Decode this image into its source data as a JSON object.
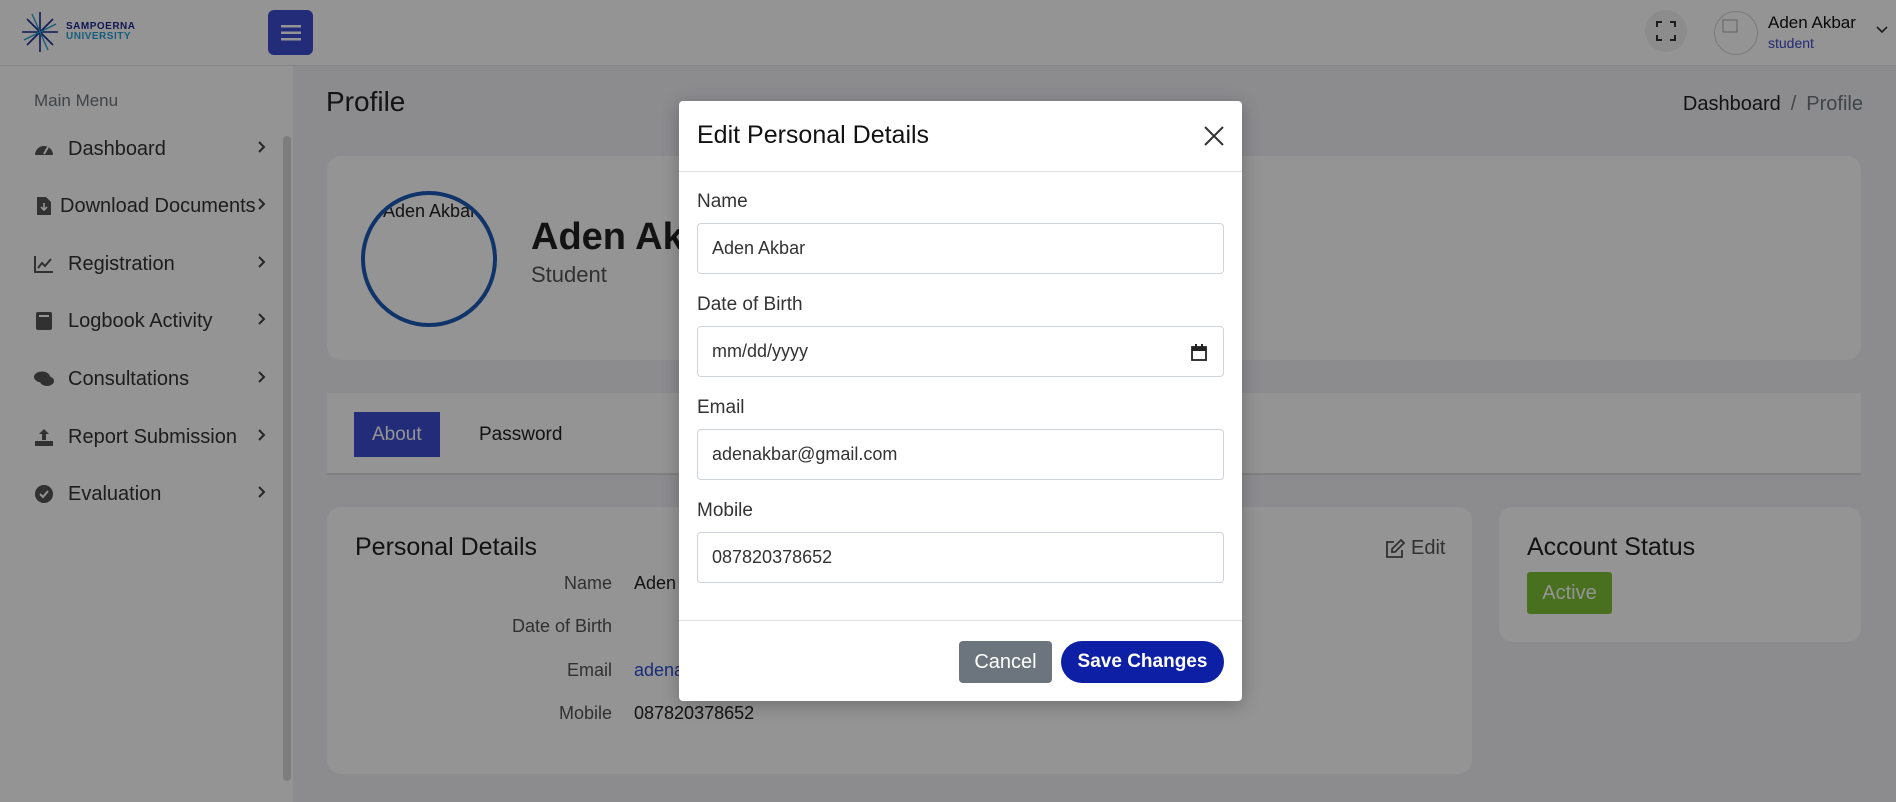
{
  "header": {
    "logo_line1": "SAMPOERNA",
    "logo_line2": "UNIVERSITY",
    "user_name": "Aden Akbar",
    "user_role": "student"
  },
  "sidebar": {
    "heading": "Main Menu",
    "items": [
      {
        "label": "Dashboard",
        "icon": "dashboard-gauge-icon"
      },
      {
        "label": "Download Documents",
        "icon": "file-download-icon"
      },
      {
        "label": "Registration",
        "icon": "chart-edit-icon"
      },
      {
        "label": "Logbook Activity",
        "icon": "book-icon"
      },
      {
        "label": "Consultations",
        "icon": "chat-bubbles-icon"
      },
      {
        "label": "Report Submission",
        "icon": "upload-icon"
      },
      {
        "label": "Evaluation",
        "icon": "check-circle-icon"
      }
    ]
  },
  "page": {
    "title": "Profile",
    "breadcrumb": [
      "Dashboard",
      "/",
      "Profile"
    ]
  },
  "profile": {
    "avatar_alt": "Aden Akbar",
    "name": "Aden Akbar",
    "role": "Student"
  },
  "tabs": [
    "About",
    "Password"
  ],
  "details": {
    "title": "Personal Details",
    "edit_label": "Edit",
    "rows": [
      {
        "label": "Name",
        "value": "Aden Akbar"
      },
      {
        "label": "Date of Birth",
        "value": ""
      },
      {
        "label": "Email",
        "value": "adenakbar@gmail.com"
      },
      {
        "label": "Mobile",
        "value": "087820378652"
      }
    ]
  },
  "account_status": {
    "title": "Account Status",
    "badge": "Active"
  },
  "modal": {
    "title": "Edit Personal Details",
    "fields": [
      {
        "label": "Name",
        "value": "Aden Akbar"
      },
      {
        "label": "Date of Birth",
        "placeholder": "mm/dd/yyyy"
      },
      {
        "label": "Email",
        "value": "adenakbar@gmail.com"
      },
      {
        "label": "Mobile",
        "value": "087820378652"
      }
    ],
    "cancel_label": "Cancel",
    "save_label": "Save Changes"
  },
  "colors": {
    "primary": "#3d4dd1",
    "save_button": "#0d1fa5",
    "status_active": "#7fc136",
    "overlay": "rgba(0,0,0,0.42)"
  }
}
